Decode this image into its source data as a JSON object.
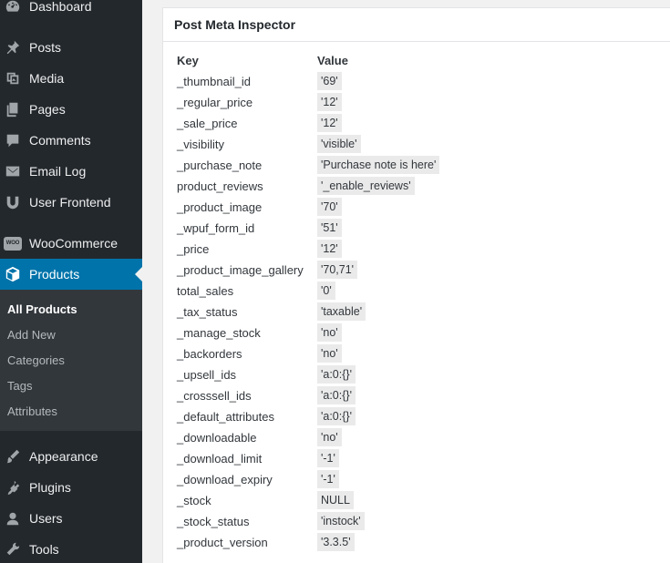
{
  "sidebar": {
    "items": [
      {
        "label": "Dashboard",
        "icon": "dashboard-icon"
      },
      {
        "label": "Posts",
        "icon": "pin-icon"
      },
      {
        "label": "Media",
        "icon": "media-icon"
      },
      {
        "label": "Pages",
        "icon": "pages-icon"
      },
      {
        "label": "Comments",
        "icon": "comment-icon"
      },
      {
        "label": "Email Log",
        "icon": "email-icon"
      },
      {
        "label": "User Frontend",
        "icon": "wpuf-icon"
      },
      {
        "label": "WooCommerce",
        "icon": "woo-icon"
      },
      {
        "label": "Products",
        "icon": "box-icon"
      },
      {
        "label": "Appearance",
        "icon": "brush-icon"
      },
      {
        "label": "Plugins",
        "icon": "plugin-icon"
      },
      {
        "label": "Users",
        "icon": "user-icon"
      },
      {
        "label": "Tools",
        "icon": "wrench-icon"
      }
    ],
    "woo_badge": "WOO",
    "submenu": [
      "All Products",
      "Add New",
      "Categories",
      "Tags",
      "Attributes"
    ],
    "active_color": "#0073aa"
  },
  "metabox": {
    "title": "Post Meta Inspector",
    "key_header": "Key",
    "value_header": "Value",
    "rows": [
      {
        "key": "_thumbnail_id",
        "value": "'69'"
      },
      {
        "key": "_regular_price",
        "value": "'12'"
      },
      {
        "key": "_sale_price",
        "value": "'12'"
      },
      {
        "key": "_visibility",
        "value": "'visible'"
      },
      {
        "key": "_purchase_note",
        "value": "'Purchase note is here'"
      },
      {
        "key": "product_reviews",
        "value": "'_enable_reviews'"
      },
      {
        "key": "_product_image",
        "value": "'70'"
      },
      {
        "key": "_wpuf_form_id",
        "value": "'51'"
      },
      {
        "key": "_price",
        "value": "'12'"
      },
      {
        "key": "_product_image_gallery",
        "value": "'70,71'"
      },
      {
        "key": "total_sales",
        "value": "'0'"
      },
      {
        "key": "_tax_status",
        "value": "'taxable'"
      },
      {
        "key": "_manage_stock",
        "value": "'no'"
      },
      {
        "key": "_backorders",
        "value": "'no'"
      },
      {
        "key": "_upsell_ids",
        "value": "'a:0:{}'"
      },
      {
        "key": "_crosssell_ids",
        "value": "'a:0:{}'"
      },
      {
        "key": "_default_attributes",
        "value": "'a:0:{}'"
      },
      {
        "key": "_downloadable",
        "value": "'no'"
      },
      {
        "key": "_download_limit",
        "value": "'-1'"
      },
      {
        "key": "_download_expiry",
        "value": "'-1'"
      },
      {
        "key": "_stock",
        "value": "NULL"
      },
      {
        "key": "_stock_status",
        "value": "'instock'"
      },
      {
        "key": "_product_version",
        "value": "'3.3.5'"
      }
    ]
  }
}
